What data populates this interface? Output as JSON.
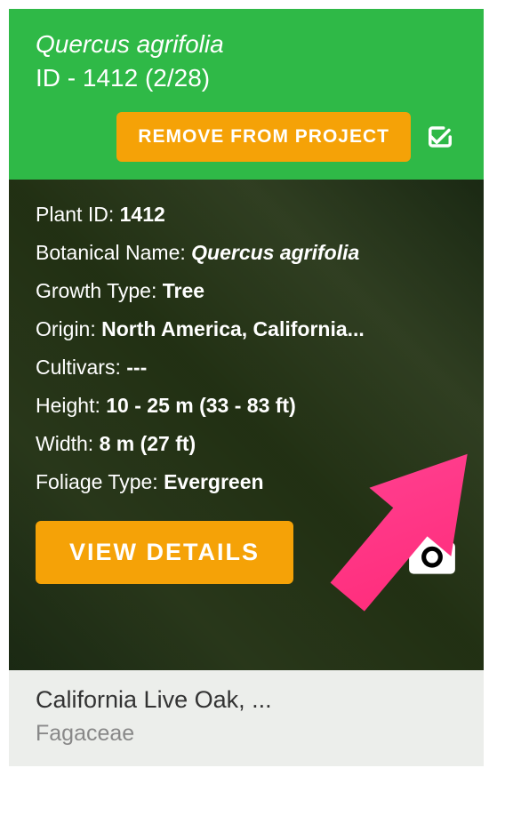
{
  "header": {
    "species_name": "Quercus agrifolia",
    "id_line": "ID - 1412 (2/28)",
    "remove_label": "REMOVE FROM PROJECT"
  },
  "info": {
    "plant_id_label": "Plant ID: ",
    "plant_id_value": "1412",
    "botanical_label": "Botanical Name: ",
    "botanical_value": "Quercus agrifolia",
    "growth_label": "Growth Type: ",
    "growth_value": "Tree",
    "origin_label": "Origin: ",
    "origin_value": "North America, California...",
    "cultivars_label": "Cultivars: ",
    "cultivars_value": "---",
    "height_label": "Height: ",
    "height_value": "10 - 25 m (33 - 83 ft)",
    "width_label": "Width: ",
    "width_value": "8 m (27 ft)",
    "foliage_label": "Foliage Type: ",
    "foliage_value": "Evergreen"
  },
  "actions": {
    "view_details_label": "VIEW DETAILS"
  },
  "footer": {
    "common_name": "California Live Oak, ...",
    "family": "Fagaceae"
  }
}
